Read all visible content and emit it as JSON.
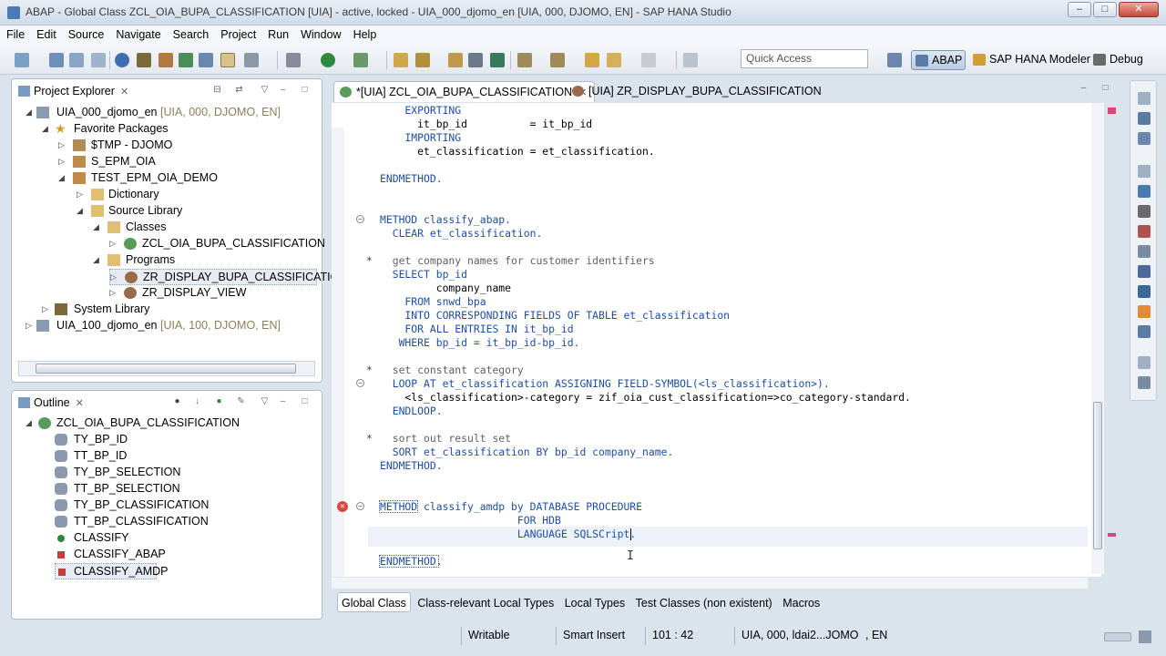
{
  "window": {
    "title": "ABAP - Global Class ZCL_OIA_BUPA_CLASSIFICATION [UIA] - active, locked - UIA_000_djomo_en [UIA, 000, DJOMO, EN] - SAP HANA Studio",
    "min": "–",
    "max": "□",
    "close": "✕"
  },
  "menu": [
    "File",
    "Edit",
    "Source",
    "Navigate",
    "Search",
    "Project",
    "Run",
    "Window",
    "Help"
  ],
  "quick_access": {
    "placeholder": "Quick Access"
  },
  "perspectives": [
    {
      "label": "ABAP"
    },
    {
      "label": "SAP HANA Modeler"
    },
    {
      "label": "Debug"
    }
  ],
  "project_explorer": {
    "title": "Project Explorer",
    "nodes": [
      {
        "label": "UIA_000_djomo_en",
        "suffix": " [UIA, 000, DJOMO, EN]"
      },
      {
        "label": "Favorite Packages"
      },
      {
        "label": "$TMP - DJOMO"
      },
      {
        "label": "S_EPM_OIA"
      },
      {
        "label": "TEST_EPM_OIA_DEMO"
      },
      {
        "label": "Dictionary"
      },
      {
        "label": "Source Library"
      },
      {
        "label": "Classes"
      },
      {
        "label": "ZCL_OIA_BUPA_CLASSIFICATION"
      },
      {
        "label": "Programs"
      },
      {
        "label": "ZR_DISPLAY_BUPA_CLASSIFICATION"
      },
      {
        "label": "ZR_DISPLAY_VIEW"
      },
      {
        "label": "System Library"
      },
      {
        "label": "UIA_100_djomo_en",
        "suffix": " [UIA, 100, DJOMO, EN]"
      }
    ]
  },
  "outline": {
    "title": "Outline",
    "root": "ZCL_OIA_BUPA_CLASSIFICATION",
    "items": [
      "TY_BP_ID",
      "TT_BP_ID",
      "TY_BP_SELECTION",
      "TT_BP_SELECTION",
      "TY_BP_CLASSIFICATION",
      "TT_BP_CLASSIFICATION",
      "CLASSIFY",
      "CLASSIFY_ABAP",
      "CLASSIFY_AMDP"
    ]
  },
  "editor": {
    "tabs": [
      {
        "label": "*[UIA] ZCL_OIA_BUPA_CLASSIFICATION",
        "close": "✕"
      },
      {
        "label": "[UIA] ZR_DISPLAY_BUPA_CLASSIFICATION"
      }
    ],
    "lines": [
      {
        "text": "    EXPORTING"
      },
      {
        "text": "      it_bp_id          = it_bp_id"
      },
      {
        "text": "    IMPORTING"
      },
      {
        "text": "      et_classification = et_classification."
      },
      {
        "text": ""
      },
      {
        "text": "ENDMETHOD."
      },
      {
        "text": ""
      },
      {
        "text": ""
      },
      {
        "text": "METHOD classify_abap."
      },
      {
        "text": "  CLEAR et_classification."
      },
      {
        "text": ""
      },
      {
        "text": "  get company names for customer identifiers"
      },
      {
        "text": "  SELECT bp_id"
      },
      {
        "text": "         company_name"
      },
      {
        "text": "    FROM snwd_bpa"
      },
      {
        "text": "    INTO CORRESPONDING FIELDS OF TABLE et_classification"
      },
      {
        "text": "    FOR ALL ENTRIES IN it_bp_id"
      },
      {
        "text": "   WHERE bp_id = it_bp_id-bp_id."
      },
      {
        "text": ""
      },
      {
        "text": "  set constant category"
      },
      {
        "text": "  LOOP AT et_classification ASSIGNING FIELD-SYMBOL(<ls_classification>)."
      },
      {
        "text": "    <ls_classification>-category = zif_oia_cust_classification=>co_category-standard."
      },
      {
        "text": "  ENDLOOP."
      },
      {
        "text": ""
      },
      {
        "text": "  sort out result set"
      },
      {
        "text": "  SORT et_classification BY bp_id company_name."
      },
      {
        "text": "ENDMETHOD."
      },
      {
        "text": ""
      },
      {
        "text": ""
      },
      {
        "text": "METHOD classify_amdp by DATABASE PROCEDURE"
      },
      {
        "text": "                      FOR HDB"
      },
      {
        "text": "                      LANGUAGE SQLSCript."
      },
      {
        "text": ""
      },
      {
        "text": "ENDMETHOD."
      }
    ],
    "bottom_tabs": [
      "Global Class",
      "Class-relevant Local Types",
      "Local Types",
      "Test Classes (non existent)",
      "Macros"
    ]
  },
  "status": {
    "mode": "Writable",
    "insert": "Smart Insert",
    "position": "101 : 42",
    "system": "UIA, 000, ldai2...JOMO",
    "lang": ", EN"
  }
}
